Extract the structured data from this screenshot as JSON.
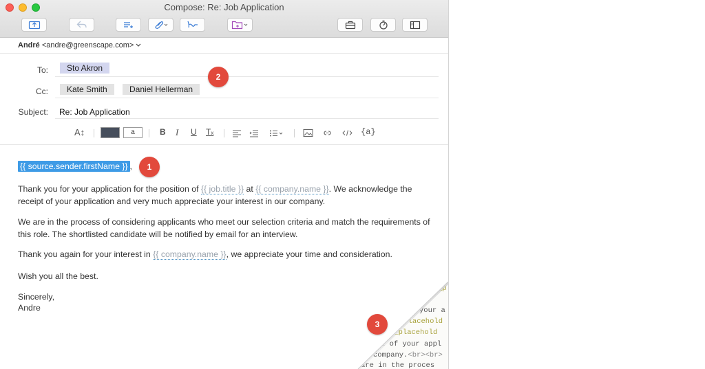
{
  "window": {
    "title": "Compose: Re: Job Application"
  },
  "from": {
    "name": "André",
    "email": "<andre@greenscape.com>"
  },
  "to": {
    "label": "To:",
    "recipients": [
      "Sto Akron"
    ]
  },
  "cc": {
    "label": "Cc:",
    "recipients": [
      "Kate Smith",
      "Daniel Hellerman"
    ]
  },
  "subject": {
    "label": "Subject:",
    "value": "Re: Job Application"
  },
  "format": {
    "font_size_glyph": "A↕",
    "bg_color_glyph": "a",
    "bold": "B",
    "italic": "I",
    "underline": "U",
    "clear": "T",
    "variable": "{a}"
  },
  "body": {
    "greeting_token": "{{ source.sender.firstName }}",
    "greeting_tail": ",",
    "p1_a": "Thank you for your application for the position of ",
    "p1_token1": "{{ job.title }}",
    "p1_b": " at ",
    "p1_token2": "{{ company.name }}",
    "p1_c": ". We acknowledge the receipt of your application and very much appreciate your interest in our company.",
    "p2": "We are in the process of considering applicants who meet our selection criteria and match the requirements of this role. The shortlisted candidate will be notified by email for an interview.",
    "p3_a": "Thank you again for your interest in ",
    "p3_token": "{{ company.name }}",
    "p3_b": ", we appreciate your time and consideration.",
    "p4": "Wish you all the best.",
    "sign1": "Sincerely,",
    "sign2": "Andre"
  },
  "badges": {
    "b1": "1",
    "b2": "2",
    "b3": "3"
  },
  "source_peek": {
    "l1": "_p",
    "l2": "your a",
    "l3": "_placehold",
    "l4": "b_placehold",
    "l5": "t of your appl",
    "l6a": "company.",
    "l6b": "<br><br>",
    "l7": "are in the proces"
  },
  "colors": {
    "accent": "#3e9be6",
    "badge": "#e2493c",
    "chip_selected": "#d3d6ef",
    "token_underline": "#4a90c2"
  }
}
